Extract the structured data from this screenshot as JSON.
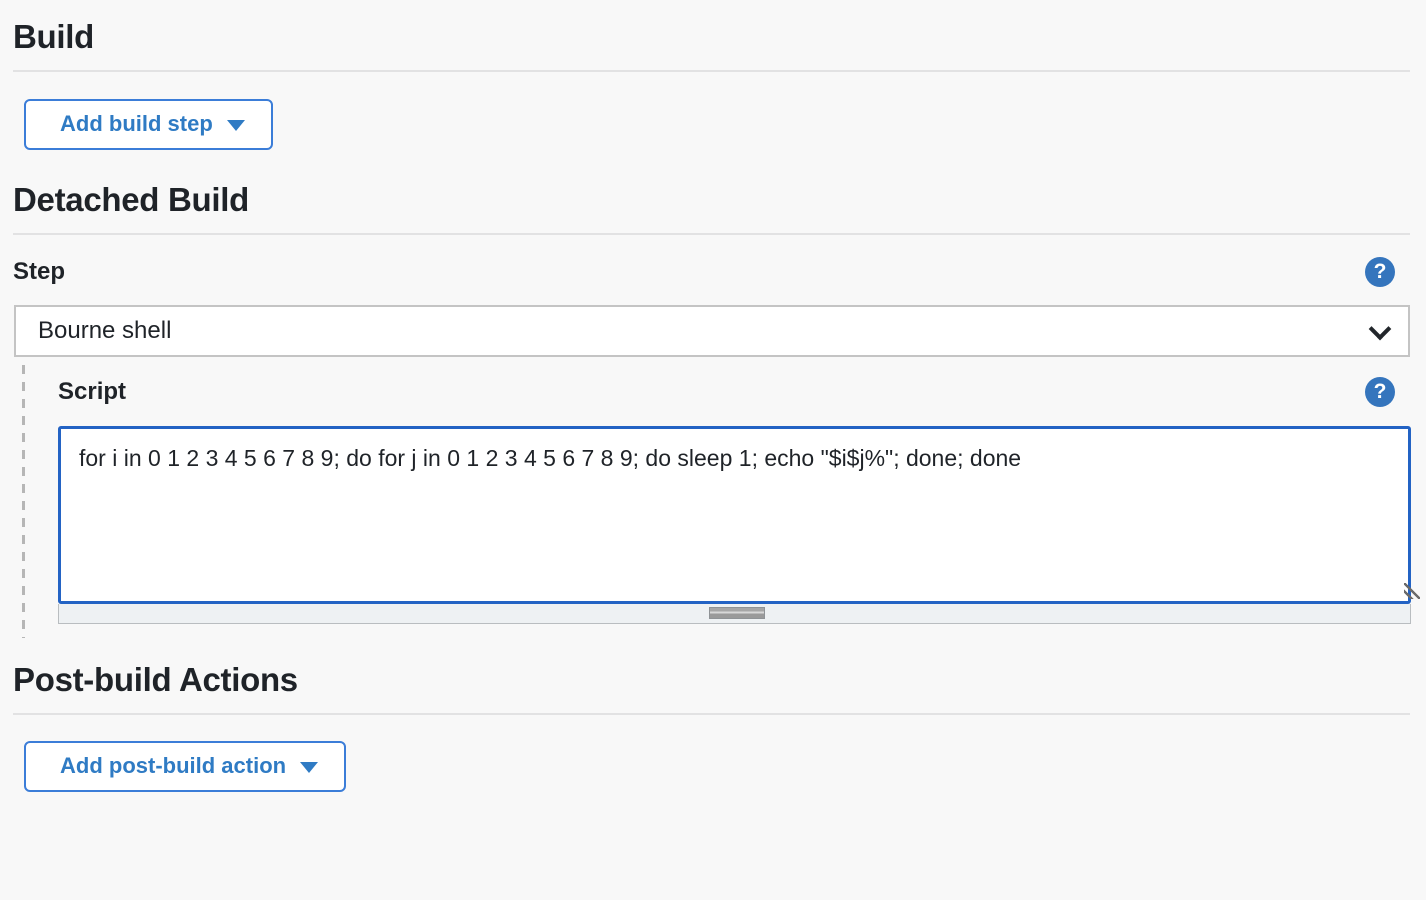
{
  "build_section": {
    "title": "Build",
    "add_build_step_label": "Add build step",
    "caret_icon": "chevron-down-icon"
  },
  "detached_build_section": {
    "title": "Detached Build",
    "step": {
      "label": "Step",
      "help_icon": "help-question-icon",
      "help_glyph": "?",
      "selected_option": "Bourne shell",
      "options": [
        "Bourne shell"
      ],
      "chevron_icon": "chevron-down-icon"
    },
    "script": {
      "label": "Script",
      "help_icon": "help-question-icon",
      "help_glyph": "?",
      "value": "for i in 0 1 2 3 4 5 6 7 8 9; do for j in 0 1 2 3 4 5 6 7 8 9; do sleep 1; echo \"$i$j%\"; done; done",
      "placeholder": ""
    }
  },
  "post_build_section": {
    "title": "Post-build Actions",
    "add_post_build_action_label": "Add post-build action",
    "caret_icon": "chevron-down-icon"
  },
  "colors": {
    "page_background": "#f8f8f8",
    "accent_blue": "#2f7bc4",
    "button_border_blue": "#3b7dd8",
    "focus_border_blue": "#2363c4",
    "help_icon_blue": "#3575bd",
    "divider_gray": "#e2e2e3",
    "text_dark": "#1f2328"
  }
}
